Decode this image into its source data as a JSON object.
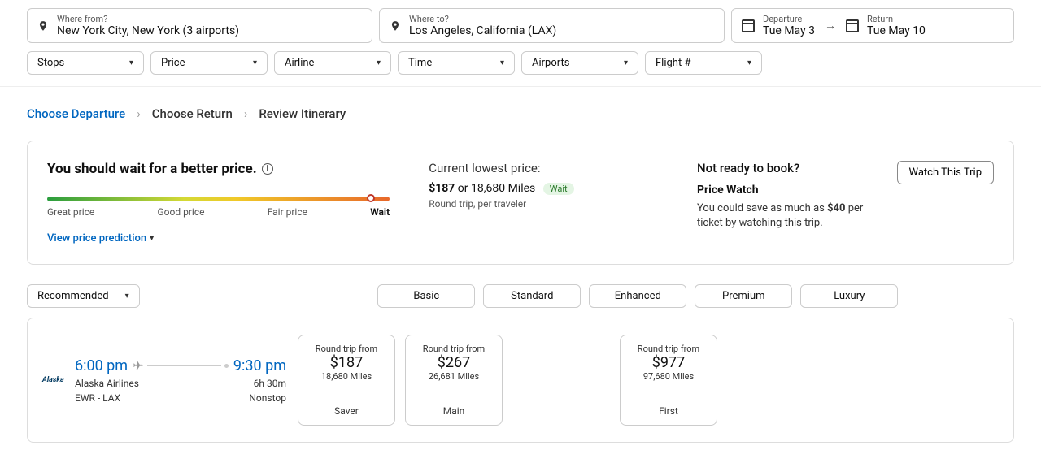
{
  "search": {
    "from_label": "Where from?",
    "from_value": "New York City, New York (3 airports)",
    "to_label": "Where to?",
    "to_value": "Los Angeles, California (LAX)",
    "departure_label": "Departure",
    "departure_value": "Tue May 3",
    "return_label": "Return",
    "return_value": "Tue May 10"
  },
  "filters": {
    "stops": "Stops",
    "price": "Price",
    "airline": "Airline",
    "time": "Time",
    "airports": "Airports",
    "flight_num": "Flight #"
  },
  "breadcrumb": {
    "step1": "Choose Departure",
    "step2": "Choose Return",
    "step3": "Review Itinerary"
  },
  "advice": {
    "headline": "You should wait for a better price.",
    "current_label": "Current lowest price:",
    "current_price": "$187",
    "or": " or ",
    "current_miles": "18,680 Miles",
    "badge": "Wait",
    "sub": "Round trip, per traveler",
    "g1": "Great price",
    "g2": "Good price",
    "g3": "Fair price",
    "g4": "Wait",
    "view_pred": "View price prediction"
  },
  "price_watch": {
    "heading": "Not ready to book?",
    "title": "Price Watch",
    "text_pre": "You could save as much as ",
    "amount": "$40",
    "text_post": " per ticket by watching this trip.",
    "button": "Watch This Trip"
  },
  "sort": {
    "label": "Recommended"
  },
  "classes": {
    "basic": "Basic",
    "standard": "Standard",
    "enhanced": "Enhanced",
    "premium": "Premium",
    "luxury": "Luxury"
  },
  "flight": {
    "logo": "Alaska",
    "dep_time": "6:00 pm",
    "arr_time": "9:30 pm",
    "airline": "Alaska Airlines",
    "duration": "6h 30m",
    "route": "EWR - LAX",
    "stops": "Nonstop"
  },
  "fares": {
    "rt_label": "Round trip from",
    "saver": {
      "price": "$187",
      "miles": "18,680 Miles",
      "name": "Saver"
    },
    "main": {
      "price": "$267",
      "miles": "26,681 Miles",
      "name": "Main"
    },
    "first": {
      "price": "$977",
      "miles": "97,680 Miles",
      "name": "First"
    }
  }
}
